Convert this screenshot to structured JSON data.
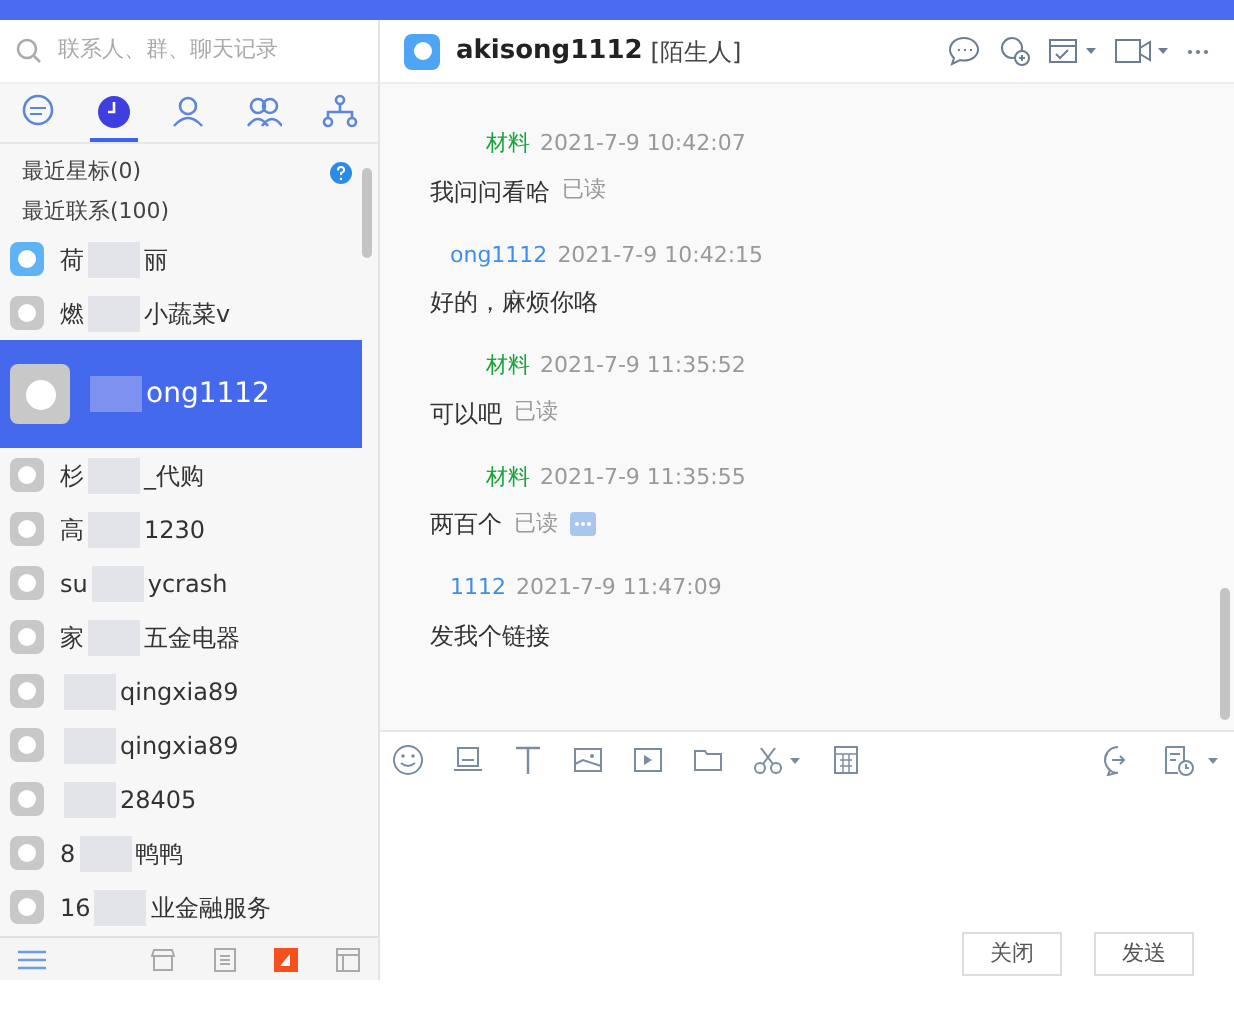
{
  "search": {
    "placeholder": "联系人、群、聊天记录"
  },
  "nav_tabs": [
    {
      "kind": "chat",
      "selected": false
    },
    {
      "kind": "recent",
      "selected": true
    },
    {
      "kind": "contact",
      "selected": false
    },
    {
      "kind": "group",
      "selected": false
    },
    {
      "kind": "org",
      "selected": false
    }
  ],
  "sections": [
    "最近星标(0)",
    "最近联系(100)"
  ],
  "contacts": [
    {
      "prefix": "荷",
      "name": "丽",
      "color": "#5eb3f7",
      "selected": false
    },
    {
      "prefix": "燃",
      "name": "小蔬菜v",
      "color": "#c8c8c8",
      "selected": false
    },
    {
      "name": "ong1112",
      "color": "#c8c8c8",
      "selected": true
    },
    {
      "prefix": "杉",
      "name": "_代购",
      "color": "#c8c8c8",
      "selected": false
    },
    {
      "prefix": "高",
      "name": "1230",
      "color": "#c8c8c8",
      "selected": false
    },
    {
      "prefix": "su",
      "name": "ycrash",
      "color": "#c8c8c8",
      "selected": false
    },
    {
      "prefix": "家",
      "name": "五金电器",
      "color": "#c8c8c8",
      "selected": false
    },
    {
      "name": "qingxia89",
      "color": "#c8c8c8",
      "selected": false
    },
    {
      "name": "qingxia89",
      "color": "#c8c8c8",
      "selected": false
    },
    {
      "name": "28405",
      "color": "#c8c8c8",
      "selected": false
    },
    {
      "prefix": "8",
      "name": "鸭鸭",
      "color": "#c8c8c8",
      "selected": false
    },
    {
      "prefix": "16",
      "name": "业金融服务",
      "color": "#c8c8c8",
      "selected": false
    }
  ],
  "chat": {
    "title": "akisong1112",
    "tag": "[陌生人]",
    "messages": [
      {
        "sender": "材料",
        "kind": "sent",
        "time": "2021-7-9 10:42:07",
        "text": "我问问看哈",
        "status": "已读",
        "more": false
      },
      {
        "sender": "ong1112",
        "kind": "received",
        "time": "2021-7-9 10:42:15",
        "text": "好的，麻烦你咯"
      },
      {
        "sender": "材料",
        "kind": "sent",
        "time": "2021-7-9 11:35:52",
        "text": "可以吧",
        "status": "已读",
        "more": false
      },
      {
        "sender": "材料",
        "kind": "sent",
        "time": "2021-7-9 11:35:55",
        "text": "两百个",
        "status": "已读",
        "more": true
      },
      {
        "sender": "1112",
        "kind": "received",
        "time": "2021-7-9 11:47:09",
        "text": "发我个链接"
      }
    ]
  },
  "buttons": [
    "关闭",
    "发送"
  ]
}
